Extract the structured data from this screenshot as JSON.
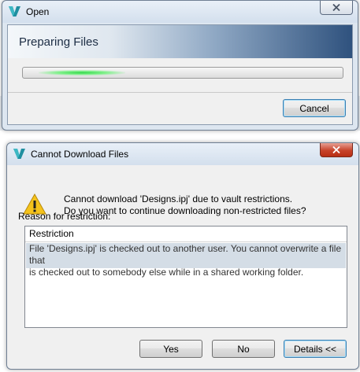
{
  "open_dialog": {
    "title": "Open",
    "banner_title": "Preparing Files",
    "cancel_label": "Cancel"
  },
  "download_dialog": {
    "title": "Cannot Download Files",
    "message_line1": "Cannot download 'Designs.ipj' due to vault restrictions.",
    "message_line2": "Do you want to continue downloading non-restricted files?",
    "reason_label": "Reason for restriction:",
    "list_header": "Restriction",
    "restriction_line1": "File 'Designs.ipj' is checked out to another user.  You cannot overwrite a file that",
    "restriction_line2": "is checked out to somebody else while in a shared working folder.",
    "yes_label": "Yes",
    "no_label": "No",
    "details_label": "Details <<"
  },
  "icons": {
    "app": "vault-v-logo-icon",
    "warning": "warning-triangle-icon",
    "close": "close-x-icon"
  },
  "colors": {
    "selected_row": "#d4dde6",
    "close_active": "#c7432a",
    "banner_dark": "#2f527e"
  }
}
